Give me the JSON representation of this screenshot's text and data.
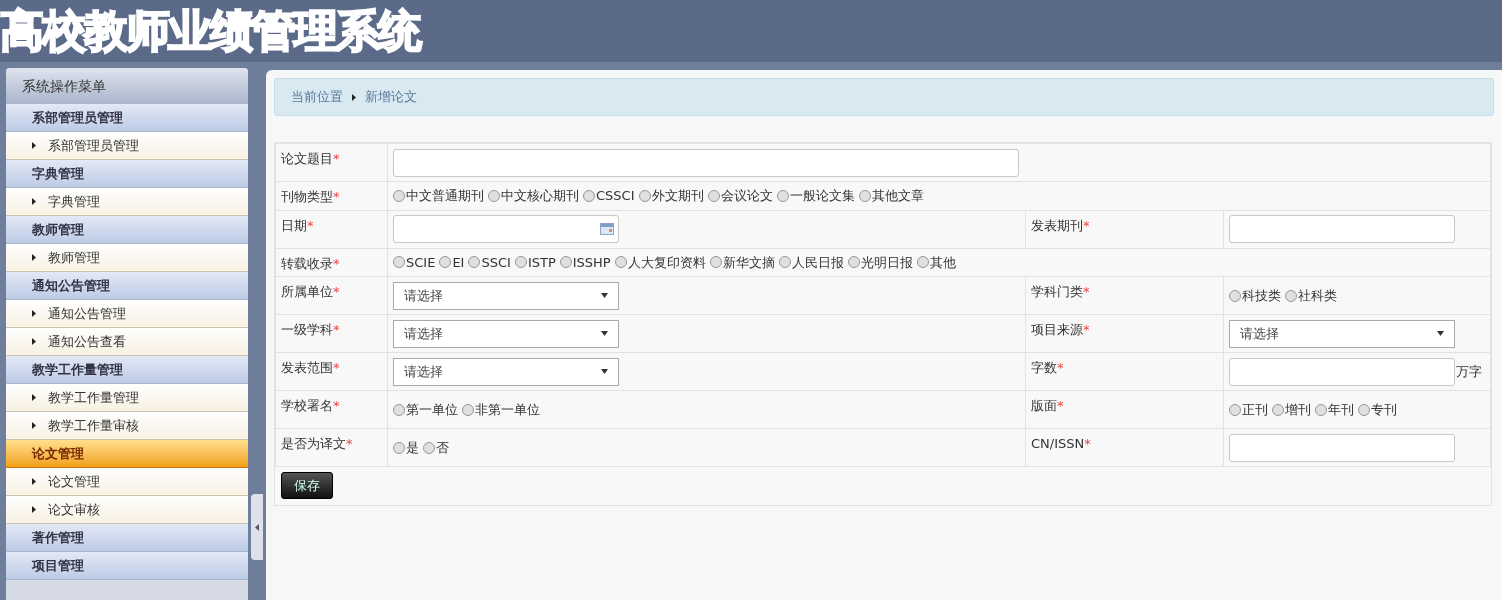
{
  "header": {
    "title": "高校教师业绩管理系统"
  },
  "sidebar": {
    "title": "系统操作菜单",
    "items": [
      {
        "kind": "group",
        "label": "系部管理员管理",
        "selected": false
      },
      {
        "kind": "link",
        "label": "系部管理员管理",
        "selected": false
      },
      {
        "kind": "group",
        "label": "字典管理",
        "selected": false
      },
      {
        "kind": "link",
        "label": "字典管理",
        "selected": false
      },
      {
        "kind": "group",
        "label": "教师管理",
        "selected": false
      },
      {
        "kind": "link",
        "label": "教师管理",
        "selected": false
      },
      {
        "kind": "group",
        "label": "通知公告管理",
        "selected": false
      },
      {
        "kind": "link",
        "label": "通知公告管理",
        "selected": false
      },
      {
        "kind": "link",
        "label": "通知公告查看",
        "selected": false
      },
      {
        "kind": "group",
        "label": "教学工作量管理",
        "selected": false
      },
      {
        "kind": "link",
        "label": "教学工作量管理",
        "selected": false
      },
      {
        "kind": "link",
        "label": "教学工作量审核",
        "selected": false
      },
      {
        "kind": "group",
        "label": "论文管理",
        "selected": true
      },
      {
        "kind": "link",
        "label": "论文管理",
        "selected": false
      },
      {
        "kind": "link",
        "label": "论文审核",
        "selected": false
      },
      {
        "kind": "group",
        "label": "著作管理",
        "selected": false
      },
      {
        "kind": "group",
        "label": "项目管理",
        "selected": false
      }
    ]
  },
  "breadcrumb": {
    "label": "当前位置",
    "current": "新增论文"
  },
  "form": {
    "rows": [
      {
        "fields": [
          {
            "label": "论文题目",
            "mark": "*",
            "kind": "text",
            "wide": true
          }
        ]
      },
      {
        "fields": [
          {
            "label": "刊物类型",
            "mark": "*",
            "kind": "radio",
            "wide": true,
            "options": [
              {
                "label": "中文普通期刊",
                "selected": false
              },
              {
                "label": "中文核心期刊",
                "selected": false
              },
              {
                "label": "CSSCI",
                "selected": false
              },
              {
                "label": "外文期刊",
                "selected": false
              },
              {
                "label": "会议论文",
                "selected": false
              },
              {
                "label": "一般论文集",
                "selected": false
              },
              {
                "label": "其他文章",
                "selected": false
              }
            ]
          }
        ]
      },
      {
        "fields": [
          {
            "label": "日期",
            "mark": "*",
            "kind": "date"
          },
          {
            "label": "发表期刊",
            "mark": "*",
            "kind": "text"
          }
        ]
      },
      {
        "fields": [
          {
            "label": "转载收录",
            "mark": "*",
            "kind": "radio",
            "wide": true,
            "options": [
              {
                "label": "SCIE",
                "selected": false
              },
              {
                "label": "EI",
                "selected": false
              },
              {
                "label": "SSCI",
                "selected": false
              },
              {
                "label": "ISTP",
                "selected": false
              },
              {
                "label": "ISSHP",
                "selected": false
              },
              {
                "label": "人大复印资料",
                "selected": false
              },
              {
                "label": "新华文摘",
                "selected": false
              },
              {
                "label": "人民日报",
                "selected": false
              },
              {
                "label": "光明日报",
                "selected": false
              },
              {
                "label": "其他",
                "selected": false
              }
            ]
          }
        ]
      },
      {
        "fields": [
          {
            "label": "所属单位",
            "mark": "*",
            "kind": "select",
            "value": "请选择"
          },
          {
            "label": "学科门类",
            "mark": "*",
            "kind": "radio",
            "options": [
              {
                "label": "科技类",
                "selected": false
              },
              {
                "label": "社科类",
                "selected": false
              }
            ]
          }
        ]
      },
      {
        "fields": [
          {
            "label": "一级学科",
            "mark": "*",
            "kind": "select",
            "value": "请选择"
          },
          {
            "label": "项目来源",
            "mark": "*",
            "kind": "select",
            "value": "请选择"
          }
        ]
      },
      {
        "fields": [
          {
            "label": "发表范围",
            "mark": "*",
            "kind": "select",
            "value": "请选择"
          },
          {
            "label": "字数",
            "mark": "*",
            "kind": "text",
            "suffix": "万字"
          }
        ]
      },
      {
        "fields": [
          {
            "label": "学校署名",
            "mark": "*",
            "kind": "radio",
            "options": [
              {
                "label": "第一单位",
                "selected": false
              },
              {
                "label": "非第一单位",
                "selected": false
              }
            ]
          },
          {
            "label": "版面",
            "mark": "*",
            "kind": "radio",
            "options": [
              {
                "label": "正刊",
                "selected": false
              },
              {
                "label": "增刊",
                "selected": false
              },
              {
                "label": "年刊",
                "selected": false
              },
              {
                "label": "专刊",
                "selected": false
              }
            ]
          }
        ]
      },
      {
        "fields": [
          {
            "label": "是否为译文",
            "mark": "*",
            "kind": "radio",
            "options": [
              {
                "label": "是",
                "selected": false
              },
              {
                "label": "否",
                "selected": false
              }
            ]
          },
          {
            "label": "CN/ISSN",
            "mark": "*",
            "kind": "text"
          }
        ]
      }
    ],
    "save_button": "保存"
  }
}
